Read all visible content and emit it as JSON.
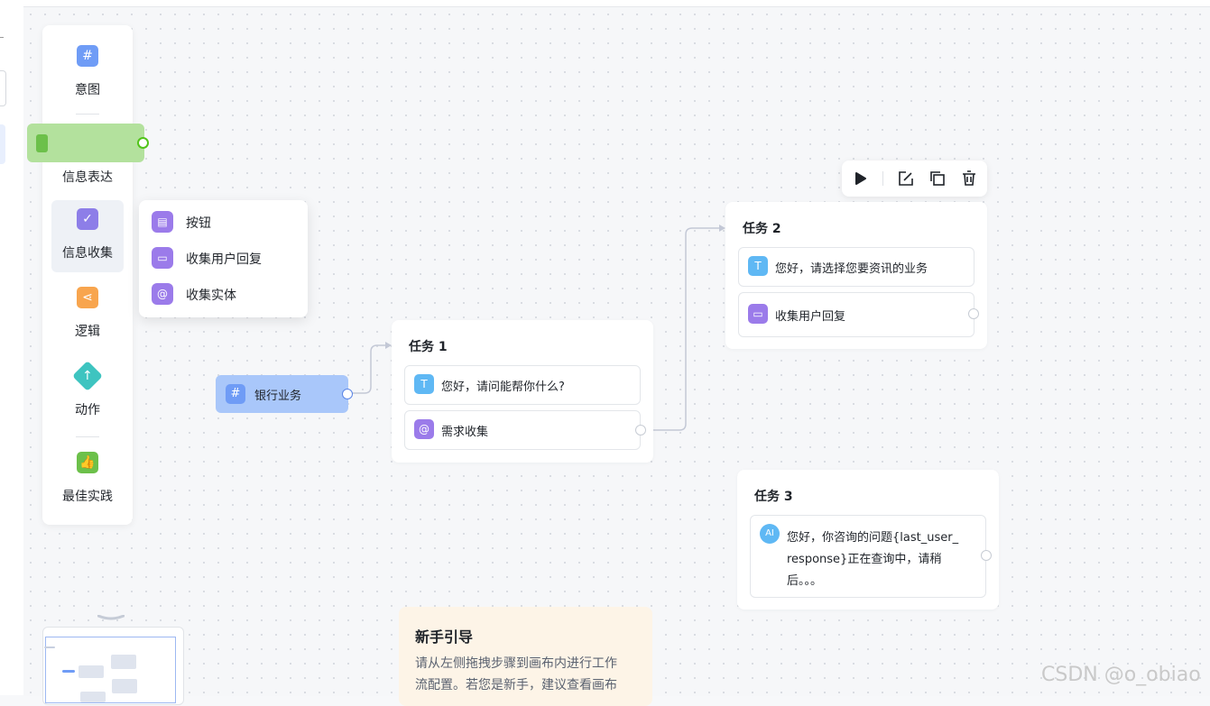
{
  "palette": {
    "items": [
      {
        "label": "意图",
        "icon": "hash-icon",
        "color": "#6f9cf6"
      },
      {
        "label": "信息表达",
        "icon": "message-icon",
        "color": "#4fb5f2"
      },
      {
        "label": "信息收集",
        "icon": "folder-check-icon",
        "color": "#8d7ee8"
      },
      {
        "label": "逻辑",
        "icon": "branch-icon",
        "color": "#f8a54e"
      },
      {
        "label": "动作",
        "icon": "action-icon",
        "color": "#3ec4c0"
      },
      {
        "label": "最佳实践",
        "icon": "thumbs-up-icon",
        "color": "#6cc04a"
      }
    ]
  },
  "popup": {
    "items": [
      {
        "label": "按钮",
        "icon": "button-icon"
      },
      {
        "label": "收集用户回复",
        "icon": "reply-form-icon"
      },
      {
        "label": "收集实体",
        "icon": "at-icon"
      }
    ]
  },
  "trigger": {
    "label": "银行业务",
    "icon": "hash-icon"
  },
  "task1": {
    "title": "任务 1",
    "steps": [
      {
        "text": "您好，请问能帮你什么?",
        "icon": "text-icon"
      },
      {
        "text": "需求收集",
        "icon": "at-icon"
      }
    ]
  },
  "task2": {
    "title": "任务 2",
    "steps": [
      {
        "text": "您好，请选择您要资讯的业务",
        "icon": "text-icon"
      },
      {
        "text": "收集用户回复",
        "icon": "reply-form-icon"
      }
    ]
  },
  "task3": {
    "title": "任务 3",
    "steps": [
      {
        "lines": [
          "您好，你咨询的问题{last_user_",
          "response}正在查询中，请稍",
          "后。。。"
        ],
        "icon": "ai-icon"
      }
    ]
  },
  "guide": {
    "title": "新手引导",
    "lines": [
      "请从左侧拖拽步骤到画布内进行工作",
      "流配置。若您是新手，建议查看画布"
    ]
  },
  "toolbar": {
    "icons": [
      "play-icon",
      "edit-icon",
      "copy-icon",
      "delete-icon"
    ]
  },
  "watermark": "CSDN @o_obiao",
  "colors": {
    "accent": "#6f9cf6",
    "purple": "#9b7bea",
    "text_icon": "#5fb8f4",
    "canvas": "#f6f7f9"
  }
}
